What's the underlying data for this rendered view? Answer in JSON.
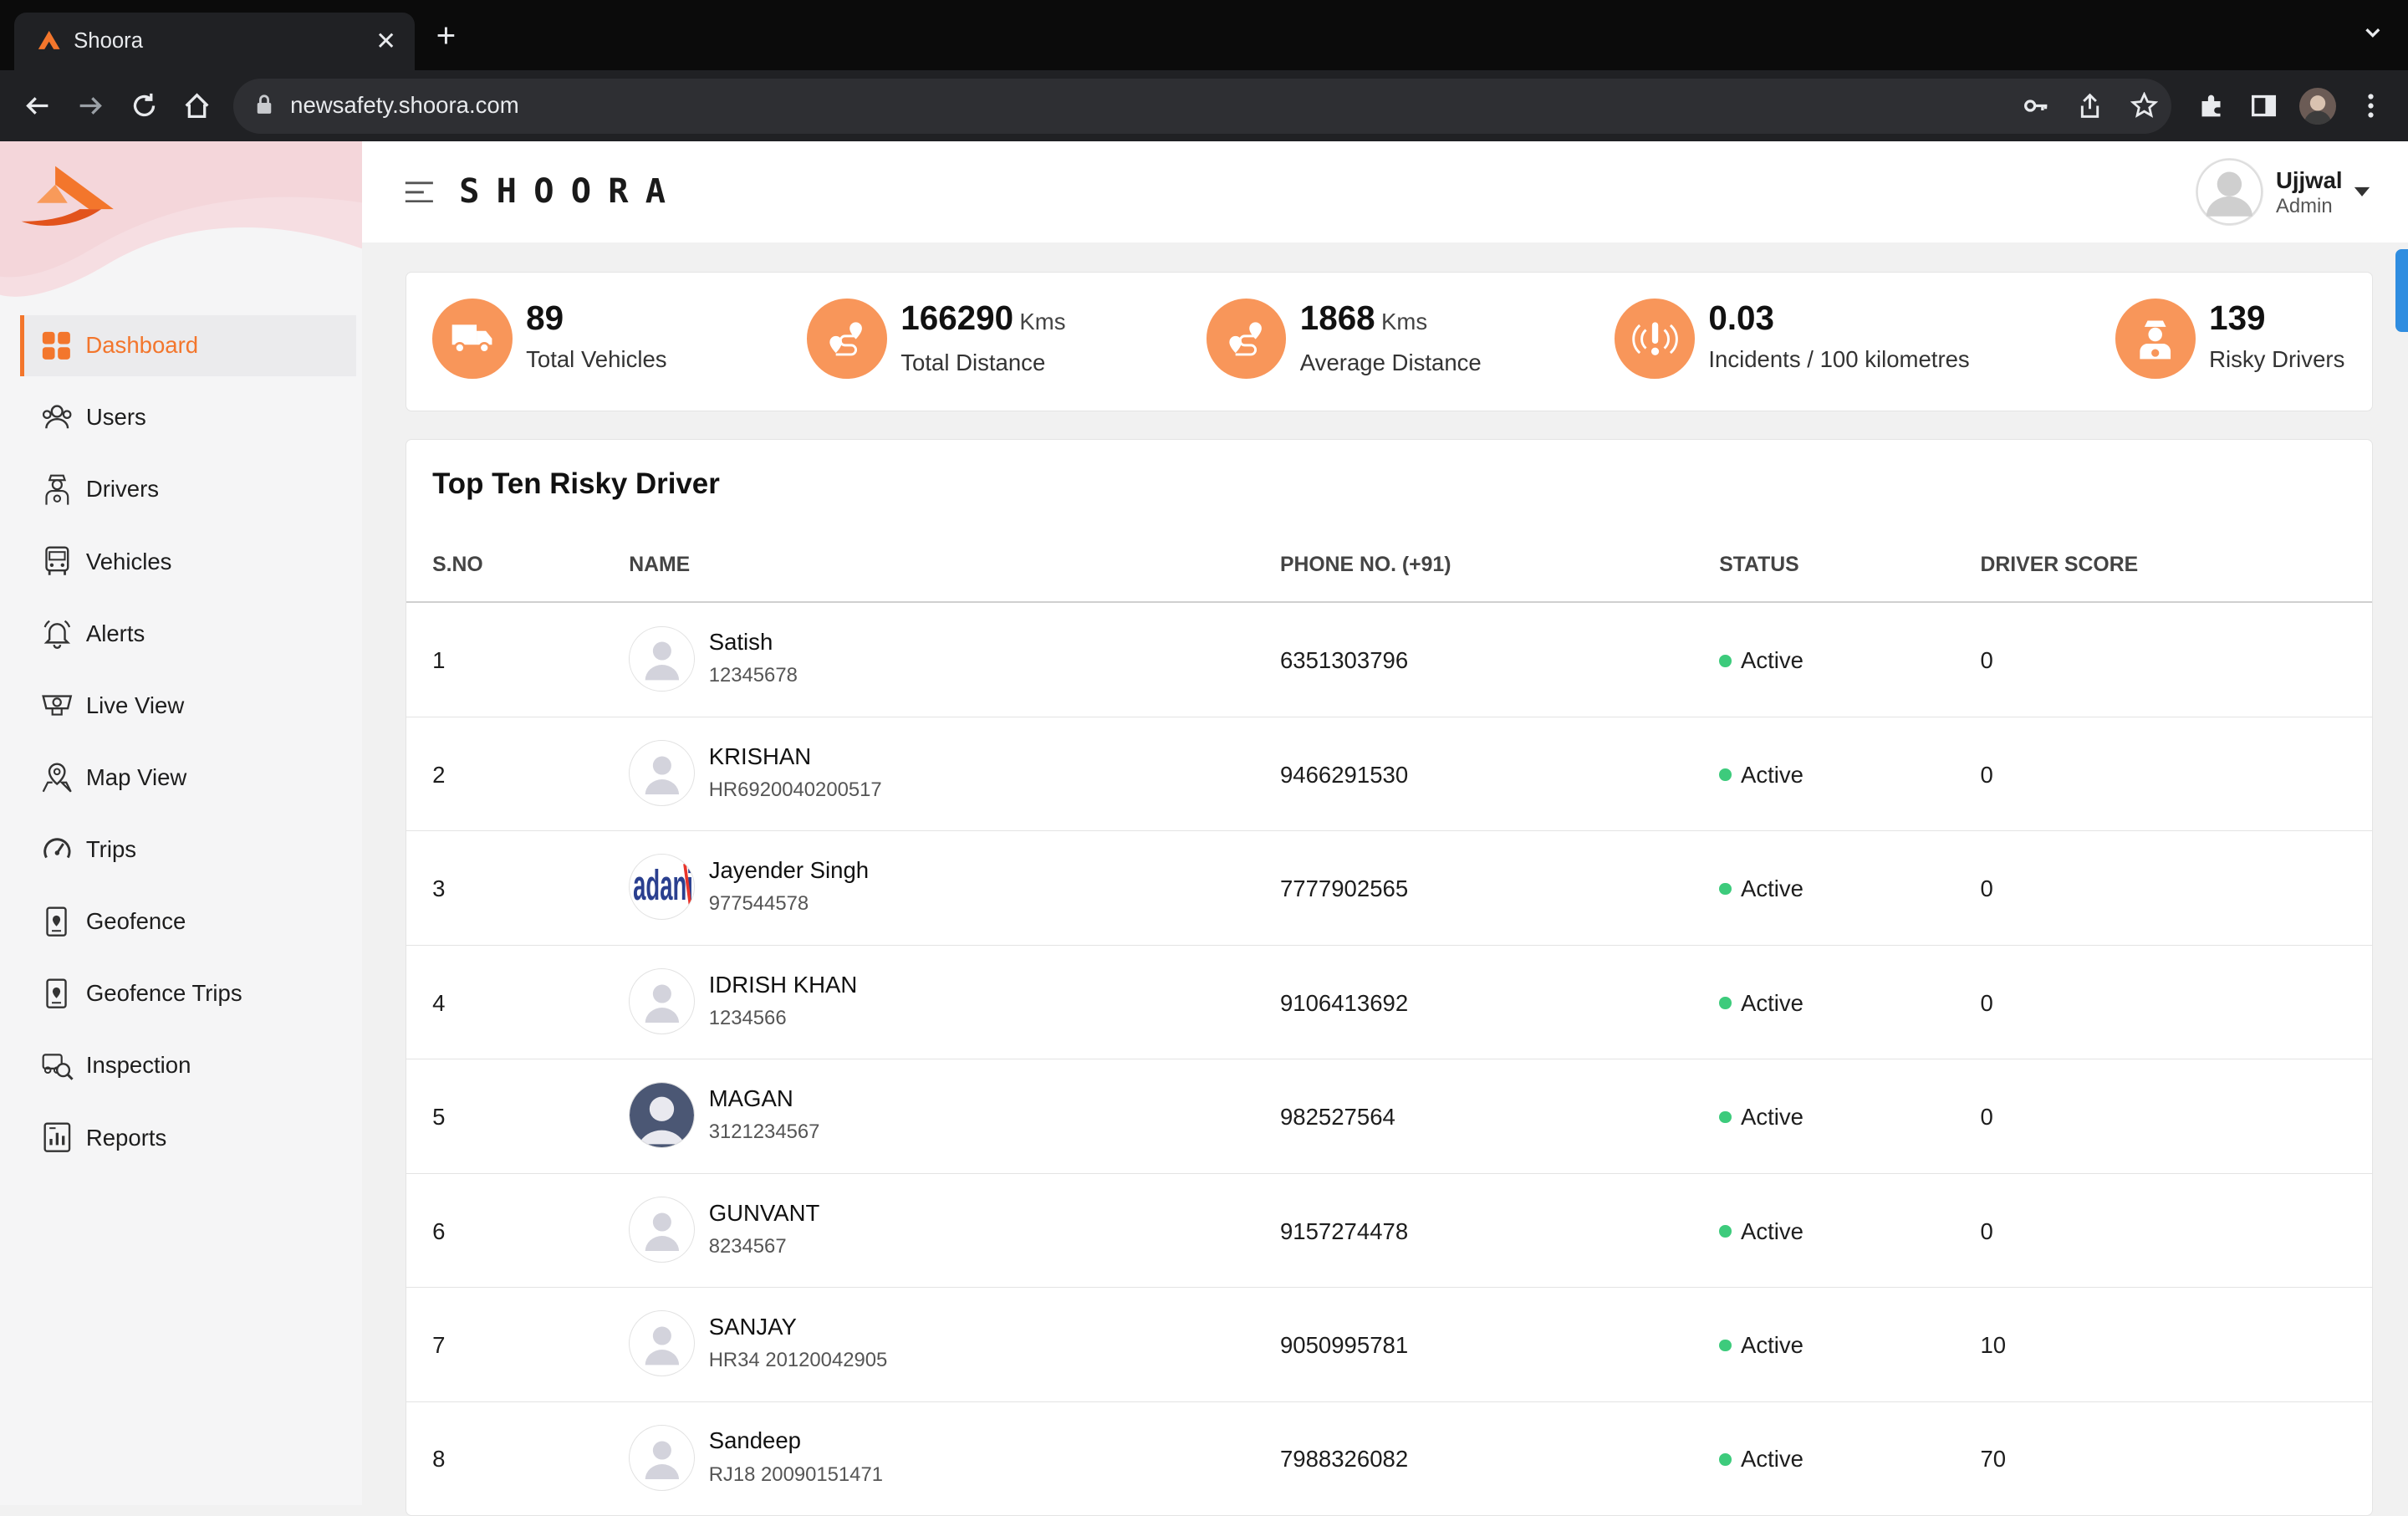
{
  "browser": {
    "tab_title": "Shoora",
    "url": "newsafety.shoora.com",
    "new_tab": "+",
    "close": "✕"
  },
  "sidebar": {
    "items": [
      {
        "label": "Dashboard",
        "icon": "dashboard-grid-icon",
        "active": true
      },
      {
        "label": "Users",
        "icon": "users-icon"
      },
      {
        "label": "Drivers",
        "icon": "driver-icon"
      },
      {
        "label": "Vehicles",
        "icon": "vehicle-icon"
      },
      {
        "label": "Alerts",
        "icon": "bell-icon"
      },
      {
        "label": "Live View",
        "icon": "camera-icon"
      },
      {
        "label": "Map View",
        "icon": "map-pin-icon"
      },
      {
        "label": "Trips",
        "icon": "speedometer-icon"
      },
      {
        "label": "Geofence",
        "icon": "geofence-icon"
      },
      {
        "label": "Geofence Trips",
        "icon": "geofence-trips-icon"
      },
      {
        "label": "Inspection",
        "icon": "inspection-icon"
      },
      {
        "label": "Reports",
        "icon": "reports-icon"
      }
    ]
  },
  "header": {
    "brand": "SHOORA",
    "user_name": "Ujjwal",
    "user_role": "Admin"
  },
  "stats": [
    {
      "value": "89",
      "unit": "",
      "label": "Total Vehicles",
      "icon": "truck-icon"
    },
    {
      "value": "166290",
      "unit": "Kms",
      "label": "Total Distance",
      "icon": "route-icon"
    },
    {
      "value": "1868",
      "unit": "Kms",
      "label": "Average Distance",
      "icon": "route-icon"
    },
    {
      "value": "0.03",
      "unit": "",
      "label": "Incidents / 100 kilometres",
      "icon": "alert-signal-icon"
    },
    {
      "value": "139",
      "unit": "",
      "label": "Risky Drivers",
      "icon": "driver-icon"
    }
  ],
  "table": {
    "title": "Top Ten Risky Driver",
    "columns": [
      "S.NO",
      "NAME",
      "PHONE NO. (+91)",
      "STATUS",
      "DRIVER SCORE"
    ],
    "rows": [
      {
        "sno": "1",
        "name": "Satish",
        "id": "12345678",
        "phone": "6351303796",
        "status": "Active",
        "score": "0",
        "avatar": "placeholder"
      },
      {
        "sno": "2",
        "name": "KRISHAN",
        "id": "HR6920040200517",
        "phone": "9466291530",
        "status": "Active",
        "score": "0",
        "avatar": "placeholder"
      },
      {
        "sno": "3",
        "name": "Jayender Singh",
        "id": "977544578",
        "phone": "7777902565",
        "status": "Active",
        "score": "0",
        "avatar": "adani-logo"
      },
      {
        "sno": "4",
        "name": "IDRISH KHAN",
        "id": "1234566",
        "phone": "9106413692",
        "status": "Active",
        "score": "0",
        "avatar": "placeholder"
      },
      {
        "sno": "5",
        "name": "MAGAN",
        "id": "3121234567",
        "phone": "982527564",
        "status": "Active",
        "score": "0",
        "avatar": "dark-user"
      },
      {
        "sno": "6",
        "name": "GUNVANT",
        "id": "8234567",
        "phone": "9157274478",
        "status": "Active",
        "score": "0",
        "avatar": "placeholder"
      },
      {
        "sno": "7",
        "name": "SANJAY",
        "id": "HR34 20120042905",
        "phone": "9050995781",
        "status": "Active",
        "score": "10",
        "avatar": "placeholder"
      },
      {
        "sno": "8",
        "name": "Sandeep",
        "id": "RJ18 20090151471",
        "phone": "7988326082",
        "status": "Active",
        "score": "70",
        "avatar": "placeholder"
      }
    ]
  },
  "colors": {
    "accent": "#f3762c",
    "stat_circle": "#f8965a",
    "status_active": "#3dcb7c"
  }
}
